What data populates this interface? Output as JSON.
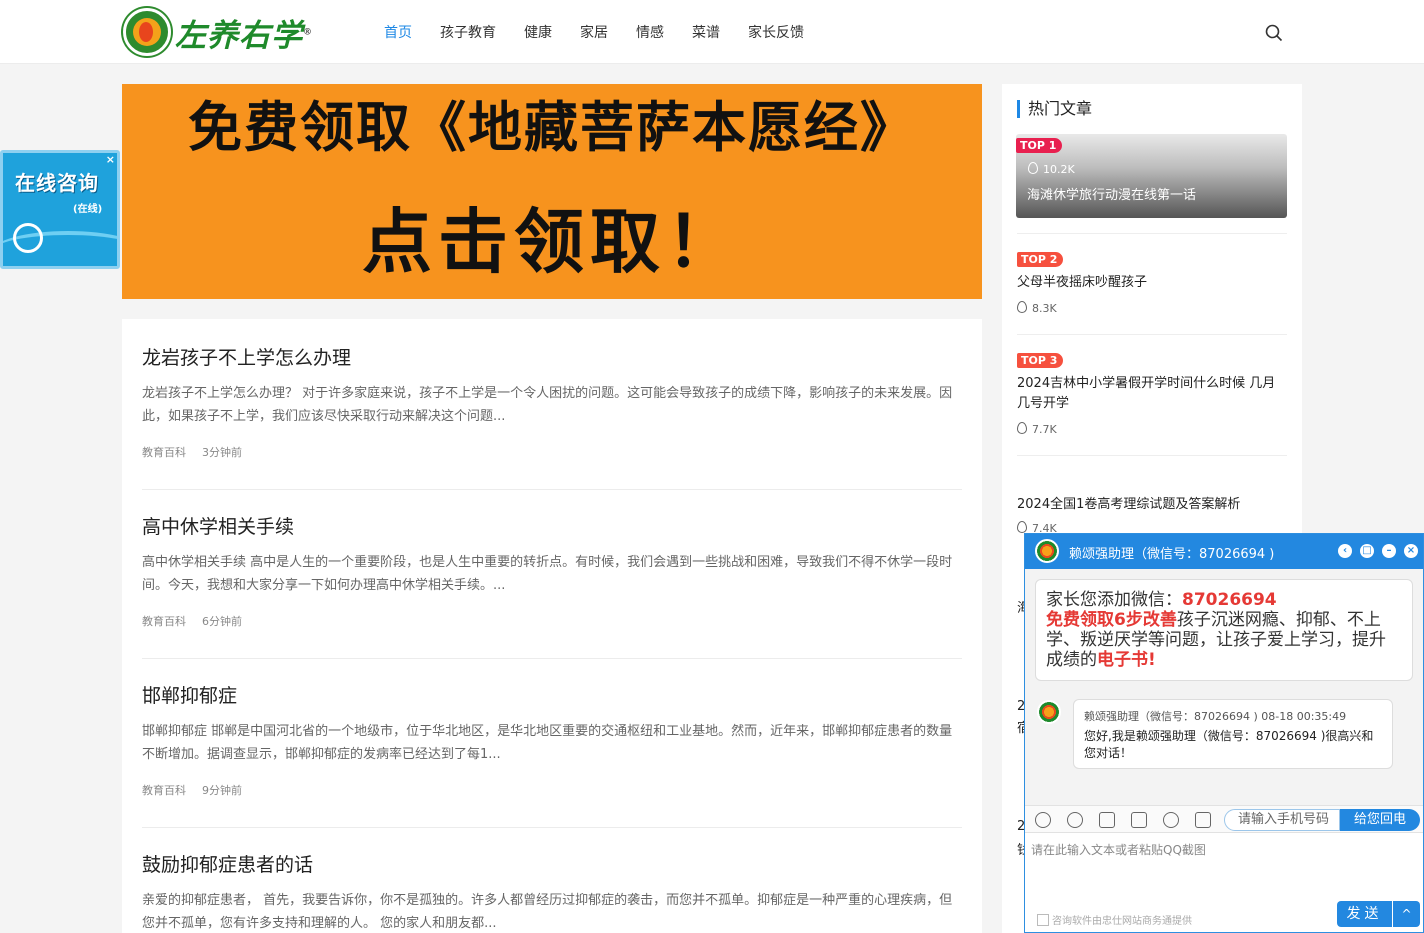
{
  "header": {
    "logo_text": "左养右学",
    "logo_reg": "®",
    "nav": [
      "首页",
      "孩子教育",
      "健康",
      "家居",
      "情感",
      "菜谱",
      "家长反馈"
    ]
  },
  "banner": {
    "line1": "免费领取《地藏菩萨本愿经》",
    "line2": "点击领取！"
  },
  "posts": [
    {
      "title": "龙岩孩子不上学怎么办理",
      "excerpt": "龙岩孩子不上学怎么办理？ 对于许多家庭来说，孩子不上学是一个令人困扰的问题。这可能会导致孩子的成绩下降，影响孩子的未来发展。因此，如果孩子不上学，我们应该尽快采取行动来解决这个问题...",
      "category": "教育百科",
      "time": "3分钟前"
    },
    {
      "title": "高中休学相关手续",
      "excerpt": "高中休学相关手续 高中是人生的一个重要阶段，也是人生中重要的转折点。有时候，我们会遇到一些挑战和困难，导致我们不得不休学一段时间。今天，我想和大家分享一下如何办理高中休学相关手续。...",
      "category": "教育百科",
      "time": "6分钟前"
    },
    {
      "title": "邯郸抑郁症",
      "excerpt": "邯郸抑郁症 邯郸是中国河北省的一个地级市，位于华北地区，是华北地区重要的交通枢纽和工业基地。然而，近年来，邯郸抑郁症患者的数量不断增加。据调查显示，邯郸抑郁症的发病率已经达到了每1...",
      "category": "教育百科",
      "time": "9分钟前"
    },
    {
      "title": "鼓励抑郁症患者的话",
      "excerpt": "亲爱的抑郁症患者， 首先，我要告诉你，你不是孤独的。许多人都曾经历过抑郁症的袭击，而您并不孤单。抑郁症是一种严重的心理疾病，但您并不孤单，您有许多支持和理解的人。 您的家人和朋友都...",
      "category": "",
      "time": ""
    }
  ],
  "sidebar": {
    "title": "热门文章",
    "items": [
      {
        "badge": "TOP 1",
        "title": "海滩休学旅行动漫在线第一话",
        "views": "10.2K"
      },
      {
        "badge": "TOP 2",
        "title": "父母半夜摇床吵醒孩子",
        "views": "8.3K"
      },
      {
        "badge": "TOP 3",
        "title": "2024吉林中小学暑假开学时间什么时候 几月几号开学",
        "views": "7.7K"
      },
      {
        "badge": "",
        "title": "2024全国1卷高考理综试题及答案解析",
        "views": "7.4K"
      }
    ],
    "covered": [
      "海",
      "2",
      "宿",
      "2",
      "钱"
    ]
  },
  "consult": {
    "title": "在线咨询",
    "status": "(在线)",
    "close": "×"
  },
  "chat": {
    "header_name": "赖颂强助理（微信号：87026694 )",
    "msg1_prefix": "家长您添加微信：",
    "msg1_wechat": "87026694",
    "msg1_highlight": "免费领取6步改善",
    "msg1_text": "孩子沉迷网瘾、抑郁、不上学、叛逆厌学等问题，让孩子爱上学习，提升成绩的",
    "msg1_book": "电子书!",
    "msg2_head": "赖颂强助理（微信号：87026694 ) 08-18 00:35:49",
    "msg2_body": "您好,我是赖颂强助理（微信号：87026694 )很高兴和您对话！",
    "phone_placeholder": "请输入手机号码",
    "callback": "给您回电",
    "input_placeholder": "请在此输入文本或者粘贴QQ截图",
    "footer": "咨询软件由忠仕网站商务通提供",
    "send": "发送",
    "send_arrow": "^"
  },
  "colors": {
    "accent": "#1e88e5",
    "banner": "#f7931e",
    "chat_blue": "#2388e0",
    "logo_green": "#1f8a2b"
  }
}
